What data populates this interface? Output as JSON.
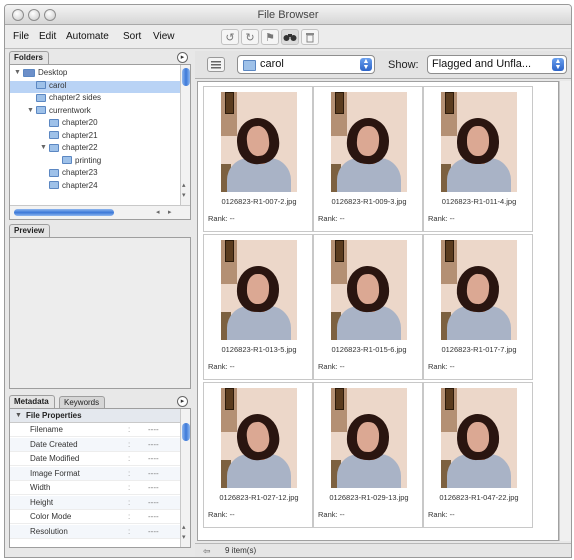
{
  "window": {
    "title": "File Browser"
  },
  "menu": [
    "File",
    "Edit",
    "Automate",
    "Sort",
    "View"
  ],
  "toolbar": {
    "icons": [
      "rotate-left-icon",
      "rotate-right-icon",
      "flag-icon",
      "binoculars-icon",
      "trash-icon"
    ]
  },
  "folders_panel": {
    "tab_label": "Folders",
    "items": [
      {
        "label": "Desktop",
        "depth": 0,
        "expanded": true,
        "selected": false
      },
      {
        "label": "carol",
        "depth": 1,
        "expanded": false,
        "selected": true
      },
      {
        "label": "chapter2 sides",
        "depth": 1,
        "expanded": false,
        "selected": false
      },
      {
        "label": "currentwork",
        "depth": 1,
        "expanded": true,
        "selected": false
      },
      {
        "label": "chapter20",
        "depth": 2,
        "expanded": false,
        "selected": false
      },
      {
        "label": "chapter21",
        "depth": 2,
        "expanded": false,
        "selected": false
      },
      {
        "label": "chapter22",
        "depth": 2,
        "expanded": true,
        "selected": false
      },
      {
        "label": "printing",
        "depth": 3,
        "expanded": false,
        "selected": false
      },
      {
        "label": "chapter23",
        "depth": 2,
        "expanded": false,
        "selected": false
      },
      {
        "label": "chapter24",
        "depth": 2,
        "expanded": false,
        "selected": false
      }
    ]
  },
  "preview_panel": {
    "tab_label": "Preview"
  },
  "metadata_panel": {
    "tab_label": "Metadata",
    "tab2_label": "Keywords",
    "section_title": "File Properties",
    "rows": [
      {
        "label": "Filename",
        "value": "----"
      },
      {
        "label": "Date Created",
        "value": "----"
      },
      {
        "label": "Date Modified",
        "value": "----"
      },
      {
        "label": "Image Format",
        "value": "----"
      },
      {
        "label": "Width",
        "value": "----"
      },
      {
        "label": "Height",
        "value": "----"
      },
      {
        "label": "Color Mode",
        "value": "----"
      },
      {
        "label": "Resolution",
        "value": "----"
      }
    ]
  },
  "location_bar": {
    "folder": "carol",
    "show_label": "Show:",
    "show_value": "Flagged and Unfla..."
  },
  "thumbnails": [
    {
      "filename": "0126823-R1-007-2.jpg",
      "rank": "Rank: --"
    },
    {
      "filename": "0126823-R1-009-3.jpg",
      "rank": "Rank: --"
    },
    {
      "filename": "0126823-R1-011-4.jpg",
      "rank": "Rank: --"
    },
    {
      "filename": "0126823-R1-013-5.jpg",
      "rank": "Rank: --"
    },
    {
      "filename": "0126823-R1-015-6.jpg",
      "rank": "Rank: --"
    },
    {
      "filename": "0126823-R1-017-7.jpg",
      "rank": "Rank: --"
    },
    {
      "filename": "0126823-R1-027-12.jpg",
      "rank": "Rank: --"
    },
    {
      "filename": "0126823-R1-029-13.jpg",
      "rank": "Rank: --"
    },
    {
      "filename": "0126823-R1-047-22.jpg",
      "rank": "Rank: --"
    }
  ],
  "status": {
    "items_text": "9 item(s)"
  },
  "colors": {
    "accent": "#3b78d8",
    "selection": "#b9d3f5"
  }
}
